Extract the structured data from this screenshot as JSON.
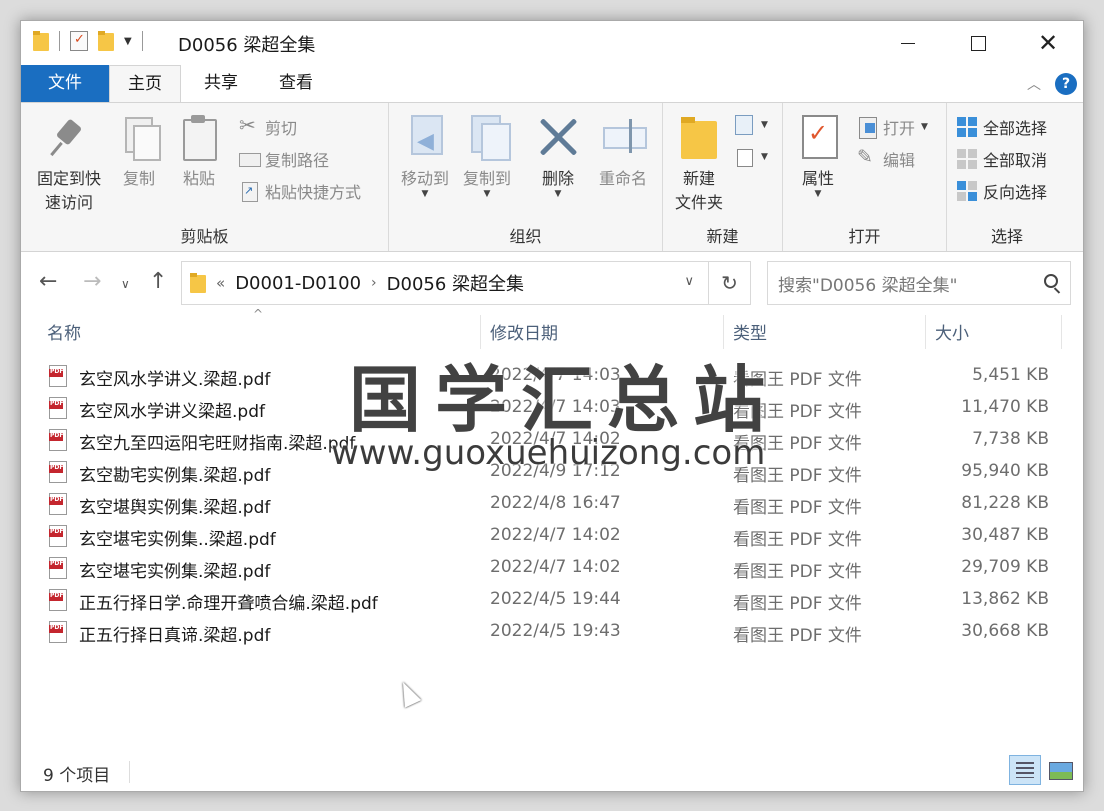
{
  "window": {
    "title": "D0056 梁超全集",
    "minimize": "",
    "maximize": "",
    "close": "✕"
  },
  "tabs": {
    "file": "文件",
    "home": "主页",
    "share": "共享",
    "view": "查看",
    "help": "?"
  },
  "ribbon": {
    "clipboard": {
      "label": "剪贴板",
      "pin": "固定到快\n速访问",
      "pin_line1": "固定到快",
      "pin_line2": "速访问",
      "copy": "复制",
      "paste": "粘贴",
      "cut": "剪切",
      "copy_path": "复制路径",
      "paste_shortcut": "粘贴快捷方式"
    },
    "organize": {
      "label": "组织",
      "move_to": "移动到",
      "copy_to": "复制到",
      "delete": "删除",
      "rename": "重命名"
    },
    "new": {
      "label": "新建",
      "new_folder_line1": "新建",
      "new_folder_line2": "文件夹"
    },
    "open": {
      "label": "打开",
      "properties": "属性",
      "open": "打开",
      "edit": "编辑"
    },
    "select": {
      "label": "选择",
      "select_all": "全部选择",
      "select_none": "全部取消",
      "invert": "反向选择"
    }
  },
  "address": {
    "crumb_overflow": "«",
    "crumb_1": "D0001-D0100",
    "crumb_sep": "›",
    "crumb_2": "D0056 梁超全集",
    "search_placeholder": "搜索\"D0056 梁超全集\""
  },
  "columns": {
    "name": "名称",
    "date": "修改日期",
    "type": "类型",
    "size": "大小"
  },
  "files": [
    {
      "name": "玄空风水学讲义.梁超.pdf",
      "date": "2022/4/7 14:03",
      "type": "看图王 PDF 文件",
      "size": "5,451 KB"
    },
    {
      "name": "玄空风水学讲义梁超.pdf",
      "date": "2022/4/7 14:03",
      "type": "看图王 PDF 文件",
      "size": "11,470 KB"
    },
    {
      "name": "玄空九至四运阳宅旺财指南.梁超.pdf",
      "date": "2022/4/7 14:02",
      "type": "看图王 PDF 文件",
      "size": "7,738 KB"
    },
    {
      "name": "玄空勘宅实例集.梁超.pdf",
      "date": "2022/4/9 17:12",
      "type": "看图王 PDF 文件",
      "size": "95,940 KB"
    },
    {
      "name": "玄空堪舆实例集.梁超.pdf",
      "date": "2022/4/8 16:47",
      "type": "看图王 PDF 文件",
      "size": "81,228 KB"
    },
    {
      "name": "玄空堪宅实例集..梁超.pdf",
      "date": "2022/4/7 14:02",
      "type": "看图王 PDF 文件",
      "size": "30,487 KB"
    },
    {
      "name": "玄空堪宅实例集.梁超.pdf",
      "date": "2022/4/7 14:02",
      "type": "看图王 PDF 文件",
      "size": "29,709 KB"
    },
    {
      "name": "正五行择日学.命理开聋喷合编.梁超.pdf",
      "date": "2022/4/5 19:44",
      "type": "看图王 PDF 文件",
      "size": "13,862 KB"
    },
    {
      "name": "正五行择日真谛.梁超.pdf",
      "date": "2022/4/5 19:43",
      "type": "看图王 PDF 文件",
      "size": "30,668 KB"
    }
  ],
  "status": {
    "item_count": "9 个项目"
  },
  "watermark": {
    "title": "国学汇总站",
    "url": "www.guoxuehuizong.com"
  }
}
